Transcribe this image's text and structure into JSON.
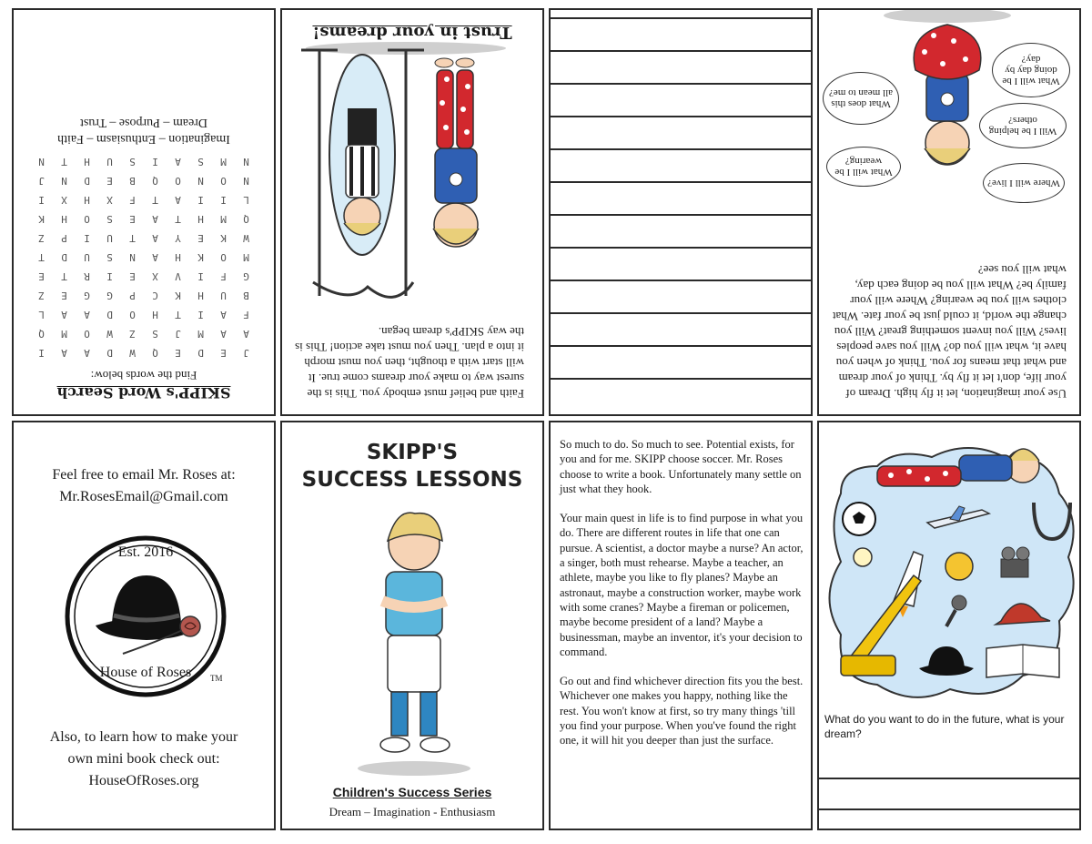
{
  "word_search": {
    "title": "SKIPP's Word Search",
    "subtitle": "Find the words below:",
    "grid": [
      [
        "J",
        "E",
        "D",
        "E",
        "Q",
        "W",
        "D",
        "A",
        "A",
        "I"
      ],
      [
        "A",
        "A",
        "M",
        "J",
        "S",
        "Z",
        "W",
        "O",
        "M",
        "Q"
      ],
      [
        "F",
        "A",
        "I",
        "T",
        "H",
        "O",
        "D",
        "A",
        "A",
        "L"
      ],
      [
        "B",
        "U",
        "H",
        "K",
        "C",
        "P",
        "G",
        "G",
        "E",
        "Z"
      ],
      [
        "G",
        "F",
        "I",
        "V",
        "X",
        "E",
        "I",
        "R",
        "T",
        "E"
      ],
      [
        "M",
        "O",
        "K",
        "H",
        "A",
        "N",
        "S",
        "U",
        "D",
        "T"
      ],
      [
        "W",
        "K",
        "E",
        "Y",
        "A",
        "T",
        "U",
        "I",
        "P",
        "Z"
      ],
      [
        "Q",
        "M",
        "H",
        "T",
        "A",
        "E",
        "S",
        "O",
        "H",
        "K"
      ],
      [
        "L",
        "I",
        "I",
        "A",
        "T",
        "F",
        "X",
        "H",
        "X",
        "I"
      ],
      [
        "N",
        "O",
        "N",
        "O",
        "Q",
        "B",
        "E",
        "D",
        "N",
        "J"
      ],
      [
        "N",
        "M",
        "S",
        "A",
        "I",
        "S",
        "U",
        "H",
        "T",
        "N",
        "E"
      ]
    ],
    "words_line1": "Imagination – Enthusiasm – Faith",
    "words_line2": "Dream – Purpose – Trust"
  },
  "mirror_page": {
    "text": "Faith and belief must embody you. This is the surest way to make your dreams come true. It will start with a thought, then you must morph it into a plan. Then you must take action! This is the way SKIPP's dream began.",
    "title": "Trust in your dreams!"
  },
  "notes_page": {
    "line_count": 12
  },
  "imagination_page": {
    "text": "Use your imagination, let it fly high. Dream of your life, don't let it fly by. Think of your dream and what that means for you. Think of when you have it, what will you do? Will you save peoples lives? Will you invent something great? Will you change the world, it could just be your fate. What clothes will you be wearing? Where will your family be? What will you be doing each day, what will you see?",
    "bubbles": [
      "Where will I live?",
      "What will I be wearing?",
      "Will I be helping others?",
      "What does this all mean to me?",
      "What will I be doing day by day?"
    ]
  },
  "back_cover": {
    "email_line1": "Feel free to email Mr. Roses at:",
    "email_line2": "Mr.RosesEmail@Gmail.com",
    "logo_est": "Est. 2016",
    "logo_name": "House of Roses",
    "tm": "TM",
    "learn_line1": "Also, to learn how to make your",
    "learn_line2": "own mini book check out:",
    "learn_line3": "HouseOfRoses.org"
  },
  "cover": {
    "title_line1": "SKIPP'S",
    "title_line2": "SUCCESS LESSONS",
    "series": "Children's Success Series",
    "tagline": "Dream – Imagination - Enthusiasm"
  },
  "story_page": {
    "para1": "So much to do. So much to see. Potential exists, for you and for me. SKIPP choose soccer. Mr. Roses choose to write a book. Unfortunately many settle on just what they hook.",
    "para2": "Your main quest in life is to find purpose in what you do. There are different routes in life that one can pursue. A scientist, a doctor maybe a nurse? An actor, a singer, both must rehearse. Maybe a teacher, an athlete, maybe you like to fly planes? Maybe an astronaut, maybe a construction worker, maybe work with some cranes? Maybe a fireman or policemen, maybe become president of a land? Maybe a businessman, maybe an inventor, it's your decision to command.",
    "para3": "Go out and find whichever direction fits you the best. Whichever one makes you happy, nothing like the rest. You won't know at first, so try many things 'till you find your purpose. When you've found the right one, it will hit you deeper than just the surface."
  },
  "dream_page": {
    "question": "What do you want to do in the future, what is your dream?"
  },
  "colors": {
    "border": "#2a2a2a",
    "shirt_blue": "#2f5fb3",
    "pajama_red": "#d2282e",
    "hair_blond": "#e9cf7a",
    "cloud_blue": "#cfe6f7",
    "jersey_teal": "#5bb6dc"
  }
}
